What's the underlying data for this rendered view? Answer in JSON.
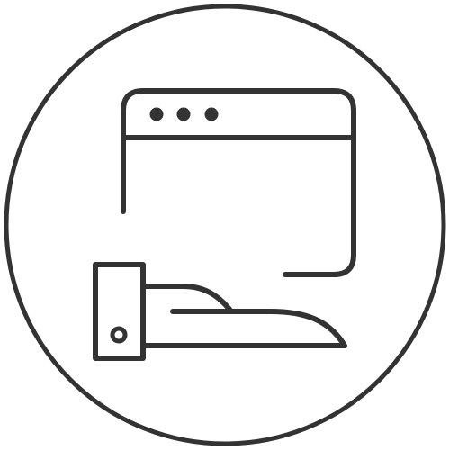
{
  "icon": {
    "name": "web-hosting-hand-browser-icon",
    "parts": [
      "outer-circle",
      "browser-window-icon",
      "browser-dot-icon",
      "hand-cuff-icon",
      "open-hand-icon"
    ]
  },
  "colors": {
    "stroke": "#333333",
    "background": "#ffffff"
  }
}
